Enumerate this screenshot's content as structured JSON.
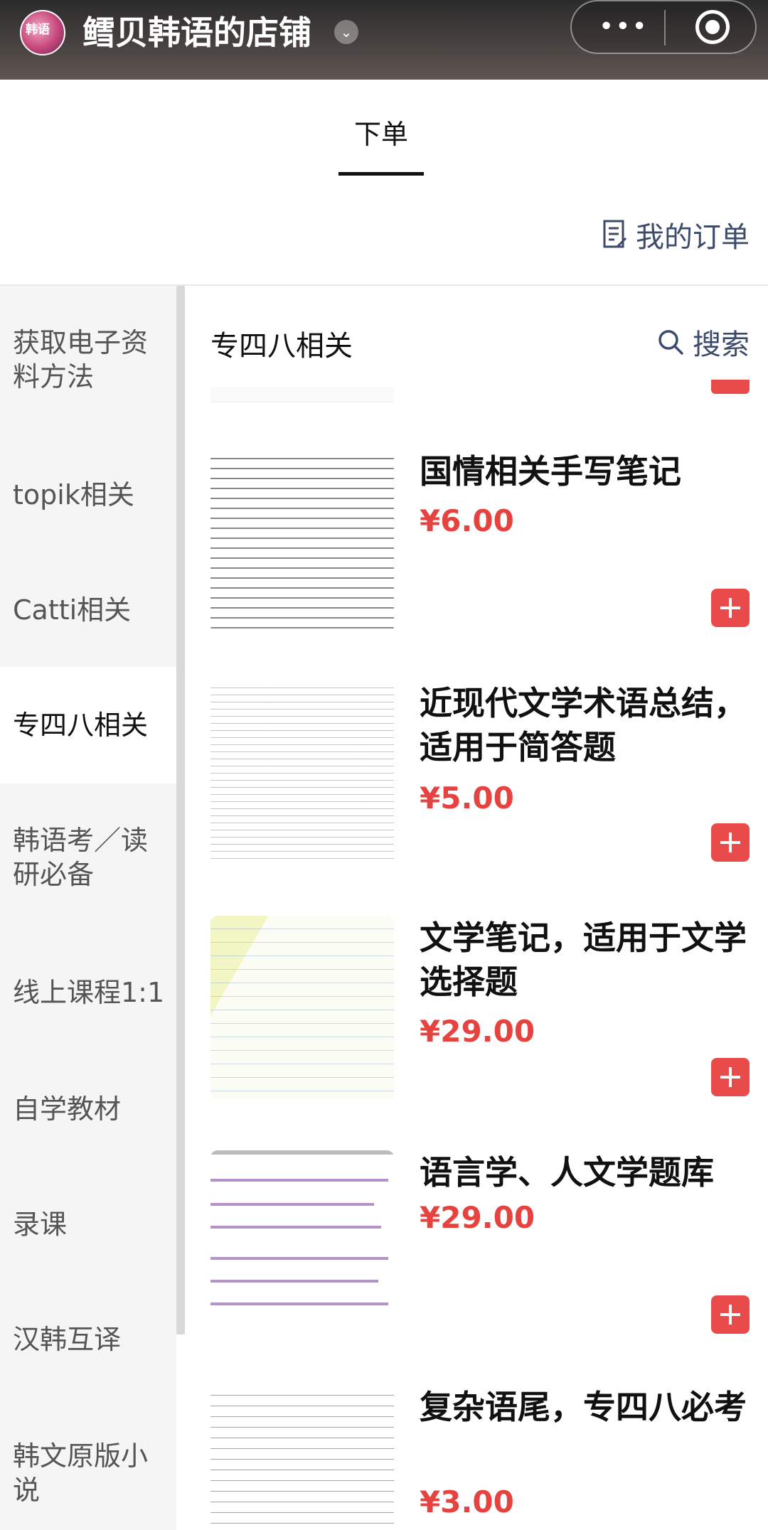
{
  "header": {
    "avatar_text": "韩语",
    "shop_name": "鳕贝韩语的店铺",
    "dropdown_icon": "chevron-down-icon",
    "more_icon": "more-dots-icon",
    "close_icon": "target-close-icon",
    "more_glyph": "•••",
    "arrow_glyph": "⌄"
  },
  "tabs": [
    {
      "label": "下单",
      "active": true
    }
  ],
  "orders": {
    "label": "我的订单",
    "icon": "document-edit-icon"
  },
  "sidebar": {
    "items": [
      {
        "label": "获取电子资料方法"
      },
      {
        "label": "topik相关"
      },
      {
        "label": "Catti相关"
      },
      {
        "label": "专四八相关",
        "active": true
      },
      {
        "label": "韩语考／读研必备"
      },
      {
        "label": "线上课程1:1"
      },
      {
        "label": "自学教材"
      },
      {
        "label": "录课"
      },
      {
        "label": "汉韩互译"
      },
      {
        "label": "韩文原版小说"
      }
    ]
  },
  "main": {
    "category_title": "专四八相关",
    "search_label": "搜索",
    "products": [
      {
        "name": "国情相关手写笔记",
        "price": "¥6.00"
      },
      {
        "name": "近现代文学术语总结，适用于简答题",
        "price": "¥5.00"
      },
      {
        "name": "文学笔记，适用于文学选择题",
        "price": "¥29.00"
      },
      {
        "name": "语言学、人文学题库",
        "price": "¥29.00"
      },
      {
        "name": "复杂语尾，专四八必考",
        "price": "¥3.00"
      }
    ]
  },
  "colors": {
    "accent": "#e94b4b",
    "price": "#e64340",
    "link": "#3c4a6b"
  }
}
